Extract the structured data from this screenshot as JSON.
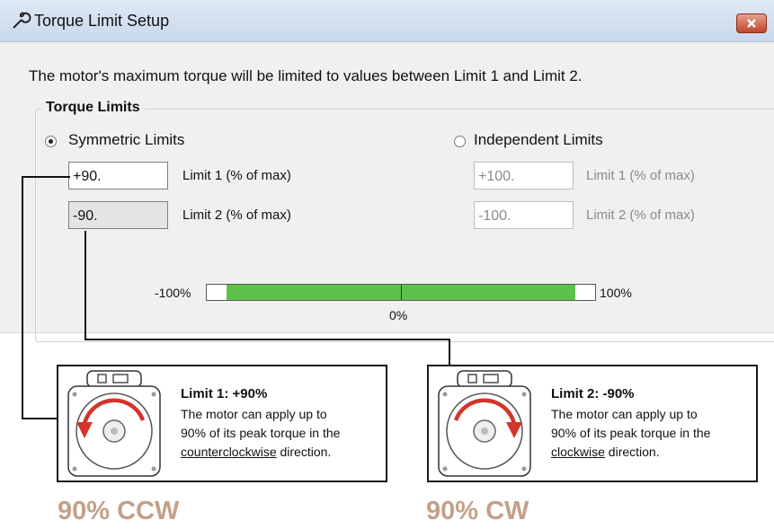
{
  "window": {
    "title": "Torque Limit Setup"
  },
  "description": "The motor's maximum torque will be limited to values between Limit 1 and Limit 2.",
  "group": {
    "legend": "Torque Limits",
    "symmetric": {
      "label": "Symmetric Limits",
      "selected": true,
      "limit1": {
        "value": "+90.",
        "label": "Limit 1 (% of max)"
      },
      "limit2": {
        "value": "-90.",
        "label": "Limit 2 (% of max)"
      }
    },
    "independent": {
      "label": "Independent Limits",
      "selected": false,
      "limit1": {
        "value": "+100.",
        "label": "Limit 1 (% of max)"
      },
      "limit2": {
        "value": "-100.",
        "label": "Limit 2 (% of max)"
      }
    }
  },
  "range_bar": {
    "min_label": "-100%",
    "max_label": "100%",
    "center_label": "0%",
    "fill_from_percent": -90,
    "fill_to_percent": 90
  },
  "callouts": [
    {
      "title": "Limit 1: +90%",
      "line1": "The motor can apply up to",
      "line2": "90% of its peak torque in the",
      "direction": "counterclockwise",
      "tail": " direction.",
      "caption": "90% CCW"
    },
    {
      "title": "Limit 2: -90%",
      "line1": "The motor can apply up to",
      "line2": "90% of its peak torque in the",
      "direction": "clockwise",
      "tail": " direction.",
      "caption": "90% CW"
    }
  ],
  "colors": {
    "bar_fill": "#5cc24a",
    "caption": "#c4a08a",
    "arrow": "#d4342a"
  }
}
